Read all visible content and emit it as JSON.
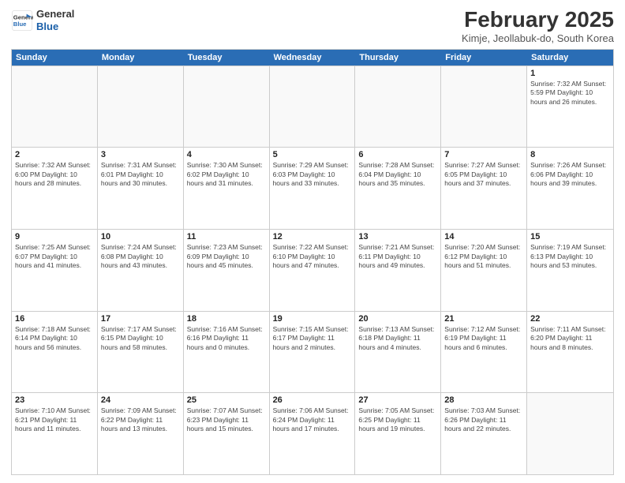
{
  "header": {
    "logo_line1": "General",
    "logo_line2": "Blue",
    "month_title": "February 2025",
    "location": "Kimje, Jeollabuk-do, South Korea"
  },
  "weekdays": [
    "Sunday",
    "Monday",
    "Tuesday",
    "Wednesday",
    "Thursday",
    "Friday",
    "Saturday"
  ],
  "rows": [
    [
      {
        "day": "",
        "info": ""
      },
      {
        "day": "",
        "info": ""
      },
      {
        "day": "",
        "info": ""
      },
      {
        "day": "",
        "info": ""
      },
      {
        "day": "",
        "info": ""
      },
      {
        "day": "",
        "info": ""
      },
      {
        "day": "1",
        "info": "Sunrise: 7:32 AM\nSunset: 5:59 PM\nDaylight: 10 hours and 26 minutes."
      }
    ],
    [
      {
        "day": "2",
        "info": "Sunrise: 7:32 AM\nSunset: 6:00 PM\nDaylight: 10 hours and 28 minutes."
      },
      {
        "day": "3",
        "info": "Sunrise: 7:31 AM\nSunset: 6:01 PM\nDaylight: 10 hours and 30 minutes."
      },
      {
        "day": "4",
        "info": "Sunrise: 7:30 AM\nSunset: 6:02 PM\nDaylight: 10 hours and 31 minutes."
      },
      {
        "day": "5",
        "info": "Sunrise: 7:29 AM\nSunset: 6:03 PM\nDaylight: 10 hours and 33 minutes."
      },
      {
        "day": "6",
        "info": "Sunrise: 7:28 AM\nSunset: 6:04 PM\nDaylight: 10 hours and 35 minutes."
      },
      {
        "day": "7",
        "info": "Sunrise: 7:27 AM\nSunset: 6:05 PM\nDaylight: 10 hours and 37 minutes."
      },
      {
        "day": "8",
        "info": "Sunrise: 7:26 AM\nSunset: 6:06 PM\nDaylight: 10 hours and 39 minutes."
      }
    ],
    [
      {
        "day": "9",
        "info": "Sunrise: 7:25 AM\nSunset: 6:07 PM\nDaylight: 10 hours and 41 minutes."
      },
      {
        "day": "10",
        "info": "Sunrise: 7:24 AM\nSunset: 6:08 PM\nDaylight: 10 hours and 43 minutes."
      },
      {
        "day": "11",
        "info": "Sunrise: 7:23 AM\nSunset: 6:09 PM\nDaylight: 10 hours and 45 minutes."
      },
      {
        "day": "12",
        "info": "Sunrise: 7:22 AM\nSunset: 6:10 PM\nDaylight: 10 hours and 47 minutes."
      },
      {
        "day": "13",
        "info": "Sunrise: 7:21 AM\nSunset: 6:11 PM\nDaylight: 10 hours and 49 minutes."
      },
      {
        "day": "14",
        "info": "Sunrise: 7:20 AM\nSunset: 6:12 PM\nDaylight: 10 hours and 51 minutes."
      },
      {
        "day": "15",
        "info": "Sunrise: 7:19 AM\nSunset: 6:13 PM\nDaylight: 10 hours and 53 minutes."
      }
    ],
    [
      {
        "day": "16",
        "info": "Sunrise: 7:18 AM\nSunset: 6:14 PM\nDaylight: 10 hours and 56 minutes."
      },
      {
        "day": "17",
        "info": "Sunrise: 7:17 AM\nSunset: 6:15 PM\nDaylight: 10 hours and 58 minutes."
      },
      {
        "day": "18",
        "info": "Sunrise: 7:16 AM\nSunset: 6:16 PM\nDaylight: 11 hours and 0 minutes."
      },
      {
        "day": "19",
        "info": "Sunrise: 7:15 AM\nSunset: 6:17 PM\nDaylight: 11 hours and 2 minutes."
      },
      {
        "day": "20",
        "info": "Sunrise: 7:13 AM\nSunset: 6:18 PM\nDaylight: 11 hours and 4 minutes."
      },
      {
        "day": "21",
        "info": "Sunrise: 7:12 AM\nSunset: 6:19 PM\nDaylight: 11 hours and 6 minutes."
      },
      {
        "day": "22",
        "info": "Sunrise: 7:11 AM\nSunset: 6:20 PM\nDaylight: 11 hours and 8 minutes."
      }
    ],
    [
      {
        "day": "23",
        "info": "Sunrise: 7:10 AM\nSunset: 6:21 PM\nDaylight: 11 hours and 11 minutes."
      },
      {
        "day": "24",
        "info": "Sunrise: 7:09 AM\nSunset: 6:22 PM\nDaylight: 11 hours and 13 minutes."
      },
      {
        "day": "25",
        "info": "Sunrise: 7:07 AM\nSunset: 6:23 PM\nDaylight: 11 hours and 15 minutes."
      },
      {
        "day": "26",
        "info": "Sunrise: 7:06 AM\nSunset: 6:24 PM\nDaylight: 11 hours and 17 minutes."
      },
      {
        "day": "27",
        "info": "Sunrise: 7:05 AM\nSunset: 6:25 PM\nDaylight: 11 hours and 19 minutes."
      },
      {
        "day": "28",
        "info": "Sunrise: 7:03 AM\nSunset: 6:26 PM\nDaylight: 11 hours and 22 minutes."
      },
      {
        "day": "",
        "info": ""
      }
    ]
  ]
}
